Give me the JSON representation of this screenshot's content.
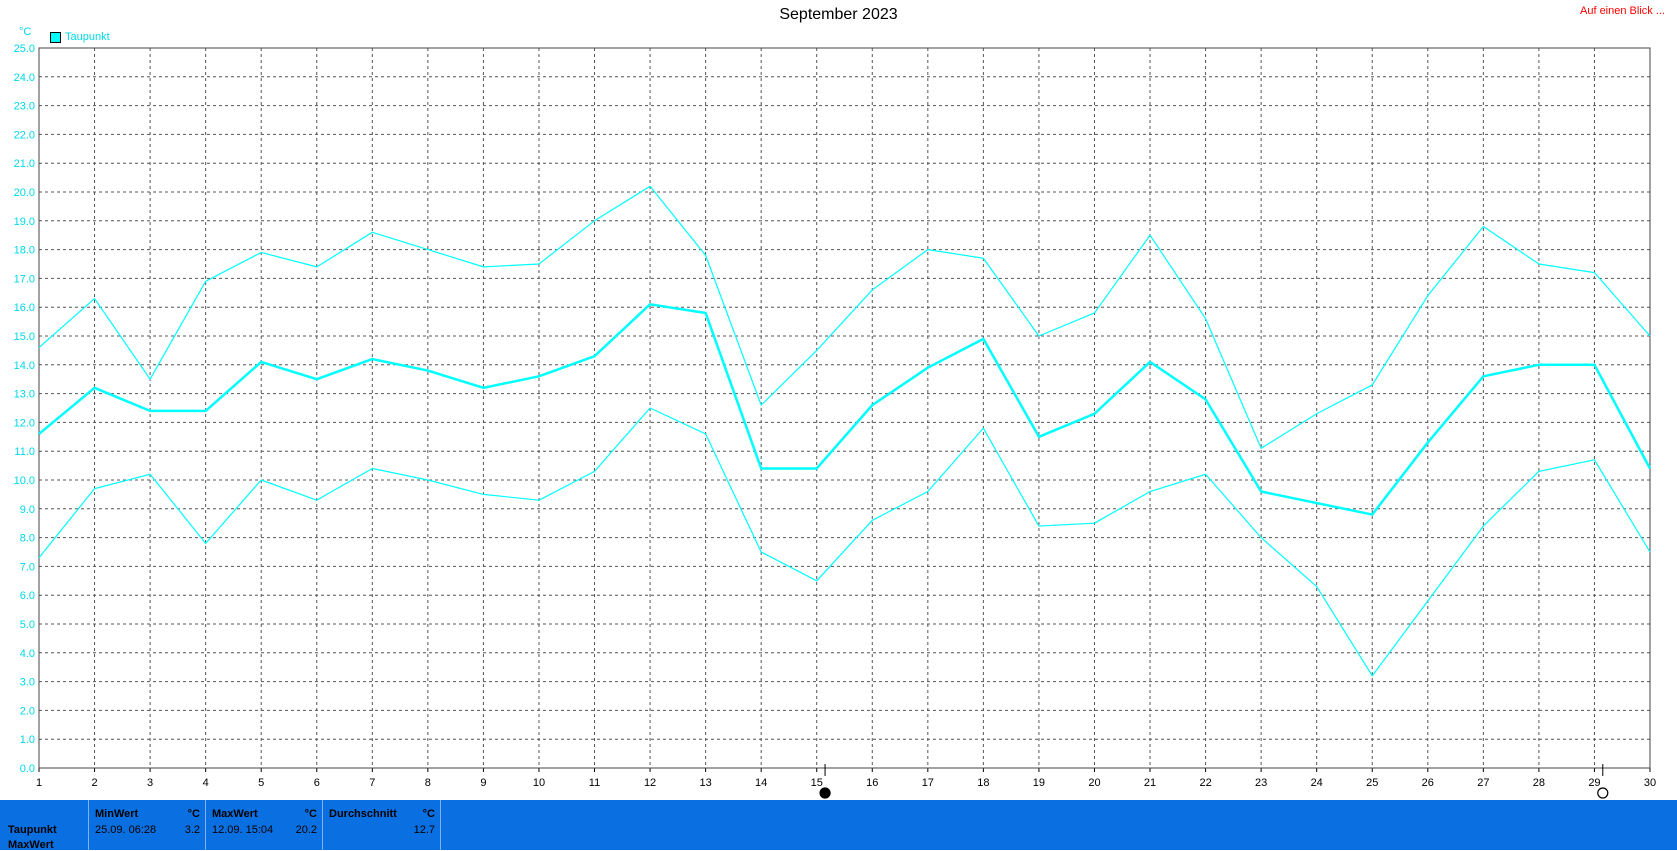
{
  "title": "September 2023",
  "top_link": "Auf einen Blick ...",
  "unit_label": "°C",
  "legend_label": "Taupunkt",
  "colors": {
    "series": "#00ffff",
    "axis_text": "#00d8e8",
    "grid": "#555555",
    "footer": "#0a6fe0"
  },
  "chart_data": {
    "type": "line",
    "x": [
      1,
      2,
      3,
      4,
      5,
      6,
      7,
      8,
      9,
      10,
      11,
      12,
      13,
      14,
      15,
      16,
      17,
      18,
      19,
      20,
      21,
      22,
      23,
      24,
      25,
      26,
      27,
      28,
      29,
      30
    ],
    "xlim": [
      1,
      30
    ],
    "ylim": [
      0,
      25
    ],
    "ylabel": "°C",
    "grid": true,
    "legend": "top-left",
    "x_ticks": [
      "1",
      "2",
      "3",
      "4",
      "5",
      "6",
      "7",
      "8",
      "9",
      "10",
      "11",
      "12",
      "13",
      "14",
      "15",
      "16",
      "17",
      "18",
      "19",
      "20",
      "21",
      "22",
      "23",
      "24",
      "25",
      "26",
      "27",
      "28",
      "29",
      "30"
    ],
    "y_ticks": [
      "0.0",
      "1.0",
      "2.0",
      "3.0",
      "4.0",
      "5.0",
      "6.0",
      "7.0",
      "8.0",
      "9.0",
      "10.0",
      "11.0",
      "12.0",
      "13.0",
      "14.0",
      "15.0",
      "16.0",
      "17.0",
      "18.0",
      "19.0",
      "20.0",
      "21.0",
      "22.0",
      "23.0",
      "24.0",
      "25.0"
    ],
    "series": [
      {
        "name": "Taupunkt",
        "role": "max",
        "values": [
          14.6,
          16.3,
          13.5,
          16.9,
          17.9,
          17.4,
          18.6,
          18.0,
          17.4,
          17.5,
          19.0,
          20.2,
          17.8,
          12.6,
          14.5,
          16.6,
          18.0,
          17.7,
          15.0,
          15.8,
          18.5,
          15.6,
          11.1,
          12.3,
          13.3,
          16.4,
          18.8,
          17.5,
          17.2,
          15.0
        ]
      },
      {
        "name": "Taupunkt",
        "role": "avg",
        "values": [
          11.6,
          13.2,
          12.4,
          12.4,
          14.1,
          13.5,
          14.2,
          13.8,
          13.2,
          13.6,
          14.3,
          16.1,
          15.8,
          10.4,
          10.4,
          12.6,
          13.9,
          14.9,
          11.5,
          12.3,
          14.1,
          12.8,
          9.6,
          9.2,
          8.8,
          11.3,
          13.6,
          14.0,
          14.0,
          10.4
        ]
      },
      {
        "name": "Taupunkt",
        "role": "min",
        "values": [
          7.3,
          9.7,
          10.2,
          7.8,
          10.0,
          9.3,
          10.4,
          10.0,
          9.5,
          9.3,
          10.3,
          12.5,
          11.6,
          7.5,
          6.5,
          8.6,
          9.6,
          11.8,
          8.4,
          8.5,
          9.6,
          10.2,
          8.0,
          6.3,
          3.2,
          5.8,
          8.4,
          10.3,
          10.7,
          7.5
        ]
      }
    ],
    "moon_phases": [
      {
        "day": 15,
        "phase": "new-moon"
      },
      {
        "day": 29,
        "phase": "full-moon"
      }
    ]
  },
  "stats": {
    "row_label": "Taupunkt",
    "row_label_2": "MaxWert",
    "min": {
      "header": "MinWert",
      "unit": "°C",
      "date": "25.09.  06:28",
      "value": "3.2"
    },
    "max": {
      "header": "MaxWert",
      "unit": "°C",
      "date": "12.09.  15:04",
      "value": "20.2"
    },
    "avg": {
      "header": "Durchschnitt",
      "unit": "°C",
      "value": "12.7"
    }
  }
}
